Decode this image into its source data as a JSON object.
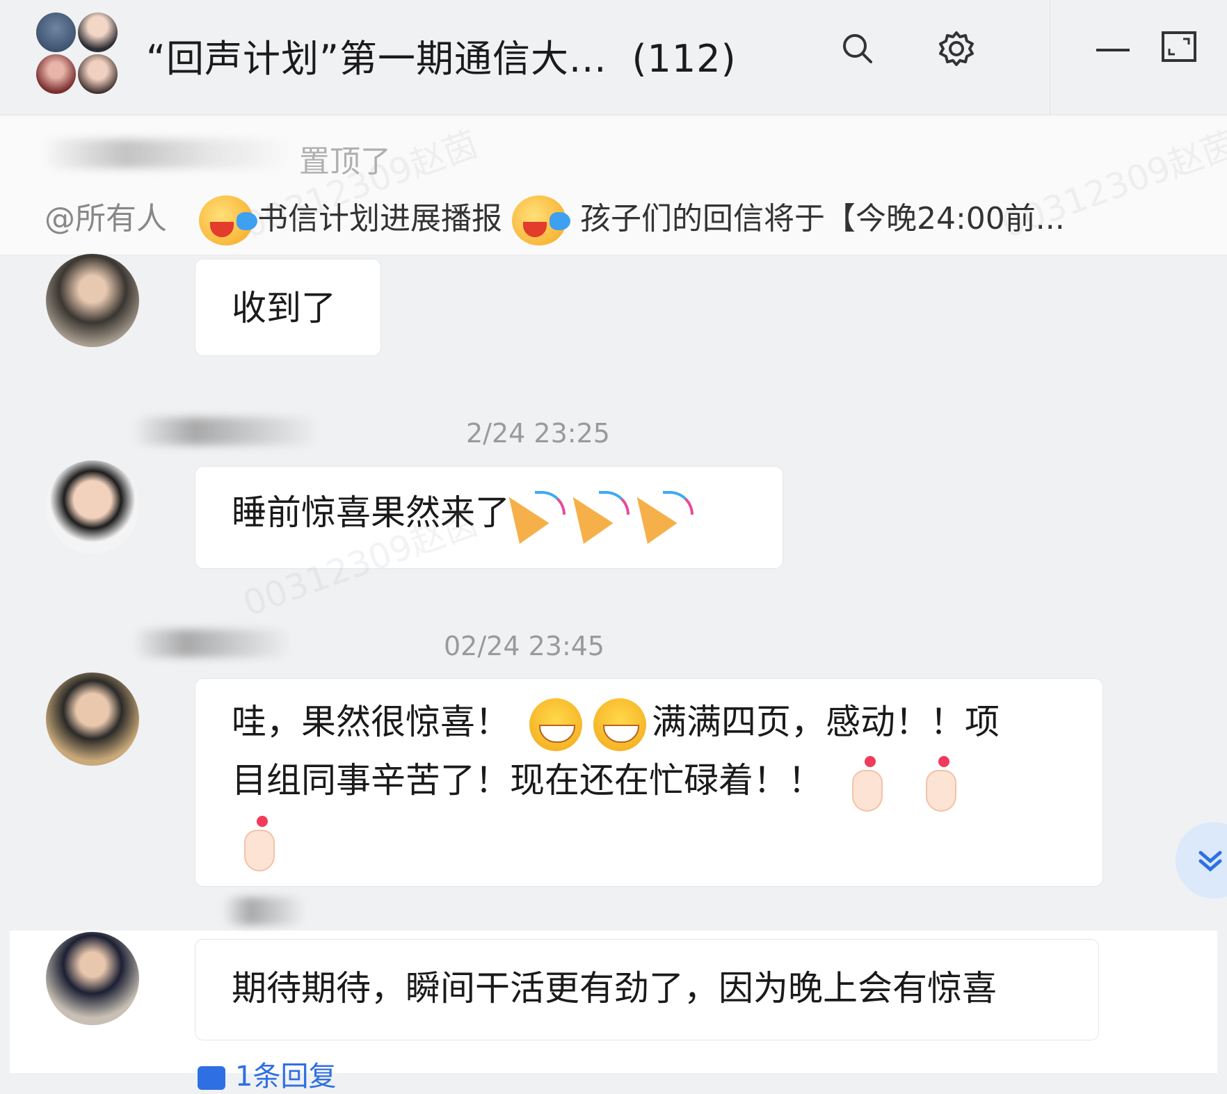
{
  "window": {
    "title": "“回声计划”第一期通信大...",
    "member_count": "(112)",
    "icons": {
      "search": "search-icon",
      "settings": "gear-icon",
      "minimize": "minimize-icon",
      "maximize": "maximize-icon"
    }
  },
  "pinned": {
    "notice": "置顶了",
    "mention": "@所有人",
    "text_1": "书信计划进展播报",
    "text_2": "孩子们的回信将于【今晚24:00前..."
  },
  "watermark": "00312309赵茵",
  "messages": [
    {
      "text": "收到了"
    },
    {
      "time": "2/24 23:25",
      "text": "睡前惊喜果然来了"
    },
    {
      "time": "02/24 23:45",
      "line1_a": "哇，果然很惊喜！",
      "line1_b": "满满四页，感动！！项",
      "line2": "目组同事辛苦了！现在还在忙碌着！！"
    },
    {
      "text": "期待期待，瞬间干活更有劲了，因为晚上会有惊喜",
      "reply": "1条回复"
    }
  ],
  "colors": {
    "accent": "#2f6fe4",
    "background": "#f0f1f3",
    "bubble": "#ffffff"
  }
}
